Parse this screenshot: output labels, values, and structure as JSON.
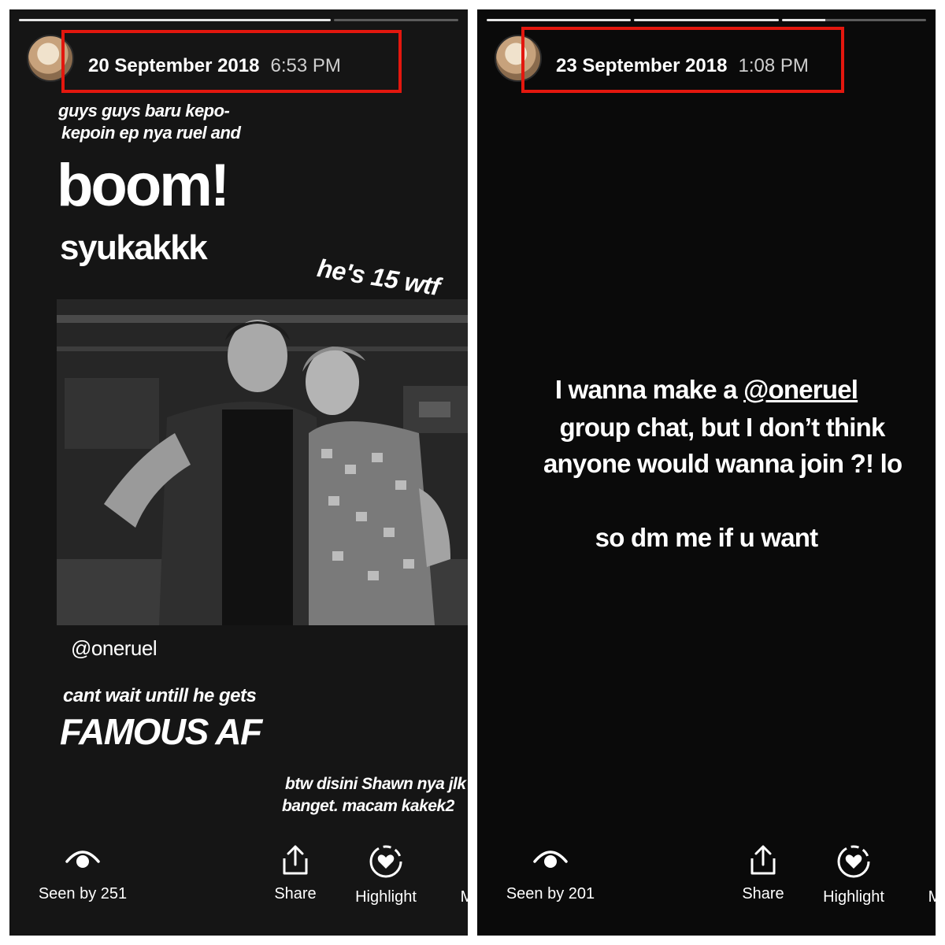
{
  "colors": {
    "story_bg_left": "#151515",
    "story_bg_right": "#0a0a0a",
    "highlight_red": "#e3170e",
    "text_primary": "#ffffff"
  },
  "left_story": {
    "date": "20 September 2018",
    "time": "6:53 PM",
    "texts": {
      "line1": "guys guys baru kepo-",
      "line2": "kepoin ep nya ruel and",
      "boom": "boom!",
      "syukakkk": "syukakkk",
      "age": "he's 15 wtf",
      "mention": "@oneruel",
      "cant_wait": "cant wait untill he gets",
      "famous": "FAMOUS AF",
      "btw1": "btw disini Shawn nya jlk",
      "btw2": "banget. macam kakek2"
    },
    "actions": {
      "seen": "Seen by 251",
      "share": "Share",
      "highlight": "Highlight",
      "more": "M"
    },
    "icons": [
      "eye-icon",
      "share-icon",
      "highlight-heart-icon"
    ]
  },
  "right_story": {
    "date": "23 September 2018",
    "time": "1:08 PM",
    "texts": {
      "line1_pre": "I wanna make a ",
      "line1_mention": "@oneruel",
      "line2": "group chat, but I don’t think",
      "line3": "anyone would wanna join ?! lo",
      "line4": "so dm me if u want"
    },
    "actions": {
      "seen": "Seen by 201",
      "share": "Share",
      "highlight": "Highlight",
      "more": "M"
    },
    "icons": [
      "eye-icon",
      "share-icon",
      "highlight-heart-icon"
    ]
  }
}
